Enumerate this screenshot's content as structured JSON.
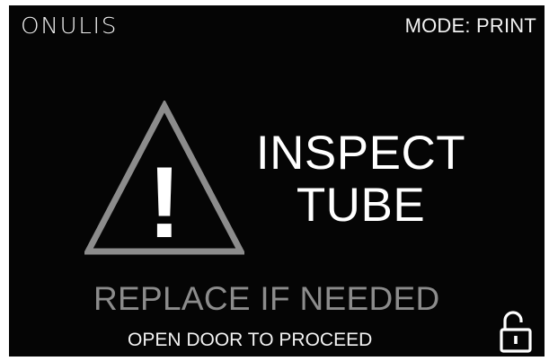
{
  "header": {
    "brand": "ONULIS",
    "mode": "MODE: PRINT"
  },
  "alert": {
    "icon": "warning-triangle-icon",
    "icon_symbol": "!",
    "title_line1": "INSPECT",
    "title_line2": "TUBE",
    "subtitle": "REPLACE IF NEEDED",
    "instruction": "OPEN DOOR TO PROCEED"
  },
  "lock": {
    "icon": "unlocked-padlock-icon"
  },
  "colors": {
    "background": "#050505",
    "text_primary": "#ffffff",
    "text_secondary": "#8c8c8c",
    "icon_stroke": "#8c8c8c"
  }
}
